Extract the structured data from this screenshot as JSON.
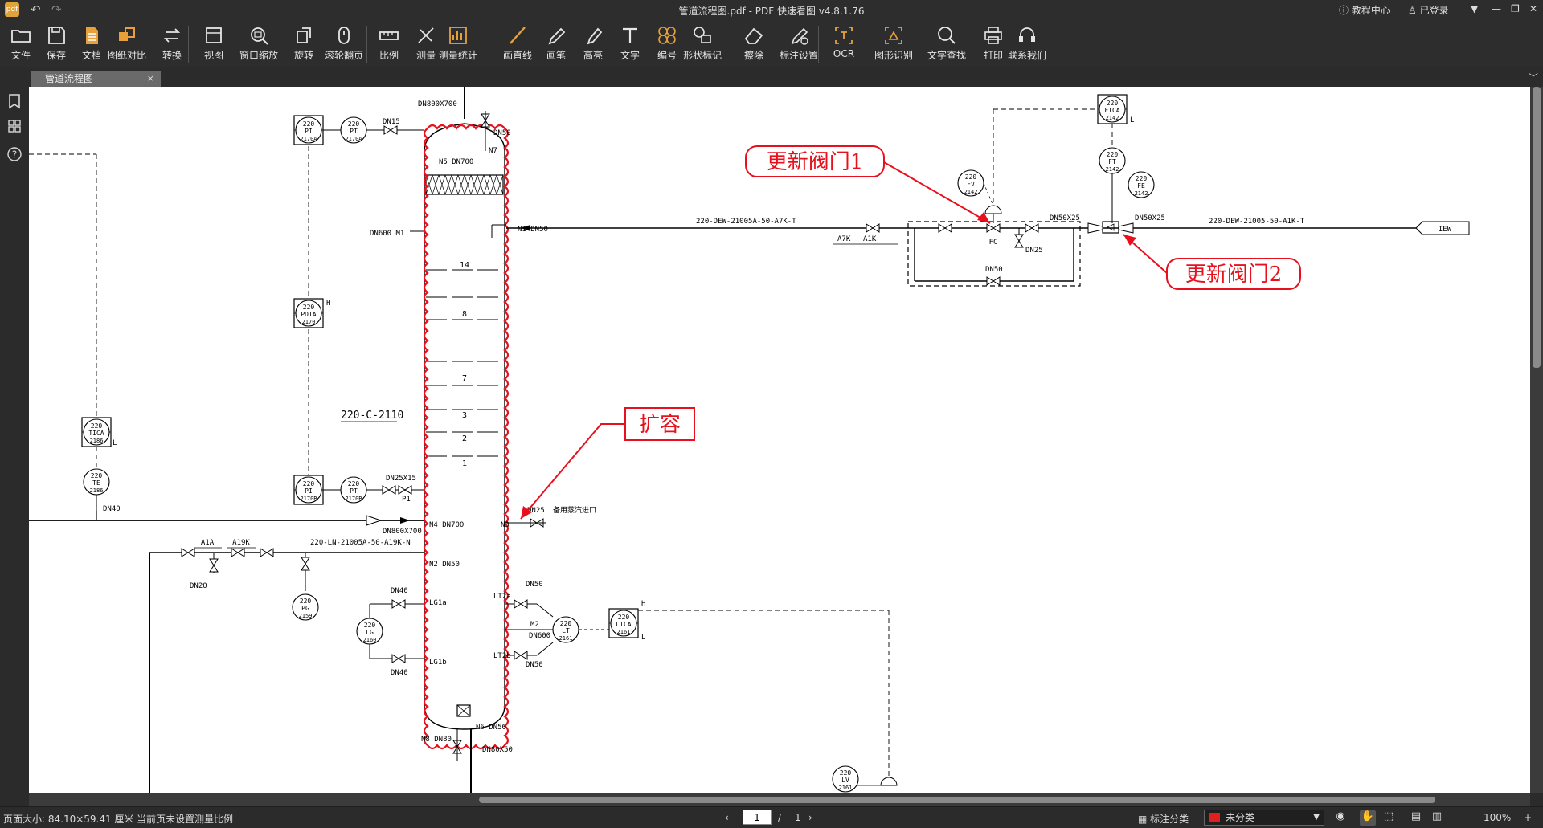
{
  "app": {
    "title": "管道流程图.pdf - PDF 快速看图 v4.8.1.76",
    "logo_text": "pdf",
    "help_center": "教程中心",
    "login": "已登录"
  },
  "toolbar": [
    {
      "id": "file",
      "label": "文件",
      "icon": "folder-icon"
    },
    {
      "id": "save",
      "label": "保存",
      "icon": "save-icon"
    },
    {
      "id": "doc",
      "label": "文档",
      "icon": "document-icon"
    },
    {
      "id": "compare",
      "label": "图纸对比",
      "icon": "compare-icon"
    },
    {
      "id": "convert",
      "label": "转换",
      "icon": "convert-icon"
    },
    {
      "id": "view",
      "label": "视图",
      "icon": "view-icon"
    },
    {
      "id": "zoomwin",
      "label": "窗口缩放",
      "icon": "zoom-window-icon"
    },
    {
      "id": "rotate",
      "label": "旋转",
      "icon": "rotate-icon"
    },
    {
      "id": "scroll",
      "label": "滚轮翻页",
      "icon": "mouse-icon"
    },
    {
      "id": "scale",
      "label": "比例",
      "icon": "ruler-icon"
    },
    {
      "id": "measure",
      "label": "测量",
      "icon": "measure-icon"
    },
    {
      "id": "stats",
      "label": "测量统计",
      "icon": "statistics-icon"
    },
    {
      "id": "line",
      "label": "画直线",
      "icon": "line-icon"
    },
    {
      "id": "pen",
      "label": "画笔",
      "icon": "pen-icon"
    },
    {
      "id": "highlight",
      "label": "高亮",
      "icon": "highlighter-icon"
    },
    {
      "id": "text",
      "label": "文字",
      "icon": "text-icon"
    },
    {
      "id": "number",
      "label": "编号",
      "icon": "numbering-icon"
    },
    {
      "id": "shape",
      "label": "形状标记",
      "icon": "shape-icon"
    },
    {
      "id": "erase",
      "label": "擦除",
      "icon": "eraser-icon"
    },
    {
      "id": "annset",
      "label": "标注设置",
      "icon": "annotation-settings-icon"
    },
    {
      "id": "ocr",
      "label": "OCR",
      "icon": "ocr-icon"
    },
    {
      "id": "shaperec",
      "label": "图形识别",
      "icon": "shape-recognition-icon"
    },
    {
      "id": "find",
      "label": "文字查找",
      "icon": "search-icon"
    },
    {
      "id": "print",
      "label": "打印",
      "icon": "printer-icon"
    },
    {
      "id": "contact",
      "label": "联系我们",
      "icon": "headset-icon"
    }
  ],
  "tab": {
    "label": "管道流程图",
    "close": "×"
  },
  "colors": {
    "accent": "#e8a13a",
    "annotation_red": "#e8101c",
    "drawing_ink": "#000000"
  },
  "drawing": {
    "tower_id": "220-C-2110",
    "trays": [
      "14",
      "8",
      "7",
      "3",
      "2",
      "1"
    ],
    "nozzles": {
      "top": "N5 DN700",
      "dn800": "DN800X700",
      "n7": "N7",
      "dn50_top": "DN50",
      "manhole": "DN600 M1",
      "n1": "N1 DN50",
      "n4": "N4 DN700",
      "n2": "N2 DN50",
      "n3": "N3",
      "dn25_steam": "DN25",
      "steam_label": "备用蒸汽进口",
      "lg1a": "LG1a",
      "lg1b": "LG1b",
      "lt2a": "LT2a",
      "lt2b": "LT2b",
      "m2": "M2",
      "dn600": "DN600",
      "dn50_a": "DN50",
      "dn50_b": "DN50",
      "dn40_a": "DN40",
      "dn40_b": "DN40",
      "n8": "N8 DN80",
      "n6": "N6 DN50",
      "dn80x50": "DN80X50",
      "dn800x700_b": "DN800X700",
      "dn25x15": "DN25X15",
      "p1": "P1",
      "dn15": "DN15",
      "dn40_te": "DN40",
      "dn20": "DN20"
    },
    "instruments": [
      {
        "tag": "PI",
        "num": "2170A",
        "loop": "220"
      },
      {
        "tag": "PT",
        "num": "2170A",
        "loop": "220"
      },
      {
        "tag": "PDIA",
        "num": "2170",
        "loop": "220"
      },
      {
        "tag": "PI",
        "num": "2170B",
        "loop": "220"
      },
      {
        "tag": "PT",
        "num": "2170B",
        "loop": "220"
      },
      {
        "tag": "TICA",
        "num": "2186",
        "loop": "220"
      },
      {
        "tag": "TE",
        "num": "2186",
        "loop": "220"
      },
      {
        "tag": "PG",
        "num": "2159",
        "loop": "220"
      },
      {
        "tag": "LG",
        "num": "2160",
        "loop": "220"
      },
      {
        "tag": "LT",
        "num": "2161",
        "loop": "220"
      },
      {
        "tag": "LICA",
        "num": "2161",
        "loop": "220"
      },
      {
        "tag": "LV",
        "num": "2161",
        "loop": "220"
      },
      {
        "tag": "FICA",
        "num": "2142",
        "loop": "220"
      },
      {
        "tag": "FT",
        "num": "2142",
        "loop": "220"
      },
      {
        "tag": "FE",
        "num": "2142",
        "loop": "220"
      },
      {
        "tag": "FV",
        "num": "2142",
        "loop": "220"
      }
    ],
    "lines": {
      "upper": "220-DEW-21005A-50-A7K-T",
      "upper_right": "220-DEW-21005-50-A1K-T",
      "lower": "220-LN-21005A-50-A19K-N",
      "spec_a7k": "A7K",
      "spec_a1k": "A1K",
      "spec_a1a": "A1A",
      "spec_a19k": "A19K",
      "dn50x25_a": "DN50X25",
      "dn50x25_b": "DN50X25",
      "dn25": "DN25",
      "dn50_bypass": "DN50",
      "fc": "FC",
      "iew": "IEW",
      "letter_h": "H",
      "letter_l": "L"
    }
  },
  "annotations": {
    "valve1": "更新阀门1",
    "valve2": "更新阀门2",
    "expand": "扩容"
  },
  "left_panel": {
    "bookmark": "bookmark-icon",
    "thumbnails": "grid-icon",
    "help": "help-icon"
  },
  "status": {
    "page_size": "页面大小: 84.10×59.41 厘米",
    "scale_note": "当前页未设置测量比例",
    "page_current": "1",
    "page_sep": "/",
    "page_total": "1",
    "annot_category_label": "标注分类",
    "category_value": "未分类",
    "zoom": "100%",
    "zoom_minus": "-",
    "zoom_plus": "+"
  }
}
